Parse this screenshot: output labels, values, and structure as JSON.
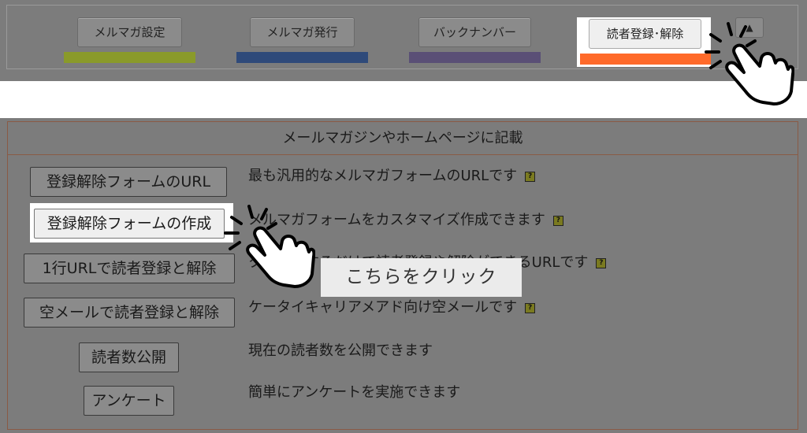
{
  "nav": {
    "tabs": [
      {
        "label": "メルマガ設定",
        "bar_color": "#8a9a2a"
      },
      {
        "label": "メルマガ発行",
        "bar_color": "#2f4a7a"
      },
      {
        "label": "バックナンバー",
        "bar_color": "#5a4f76"
      },
      {
        "label": "読者登録･解除",
        "bar_color": "#ff6a2a",
        "active": true
      }
    ],
    "up_label": "▲"
  },
  "main": {
    "header": "メールマガジンやホームページに記載",
    "rows": [
      {
        "button": "登録解除フォームのURL",
        "desc": "最も汎用的なメルマガフォームのURLです",
        "help": true
      },
      {
        "button": "登録解除フォームの作成",
        "desc": "メルマガフォームをカスタマイズ作成できます",
        "help": true,
        "active": true
      },
      {
        "button": "1行URLで読者登録と解除",
        "desc": "クリックするだけで読者登録や解除ができるURLです",
        "help": true
      },
      {
        "button": "空メールで読者登録と解除",
        "desc": "ケータイキャリアメアド向け空メールです",
        "help": true
      },
      {
        "button": "読者数公開",
        "desc": "現在の読者数を公開できます",
        "help": false
      },
      {
        "button": "アンケート",
        "desc": "簡単にアンケートを実施できます",
        "help": false
      }
    ],
    "help_glyph": "?"
  },
  "callout": {
    "text": "こちらをクリック"
  },
  "icons": {
    "pointer": "hand-pointer-icon",
    "help": "help-icon"
  }
}
